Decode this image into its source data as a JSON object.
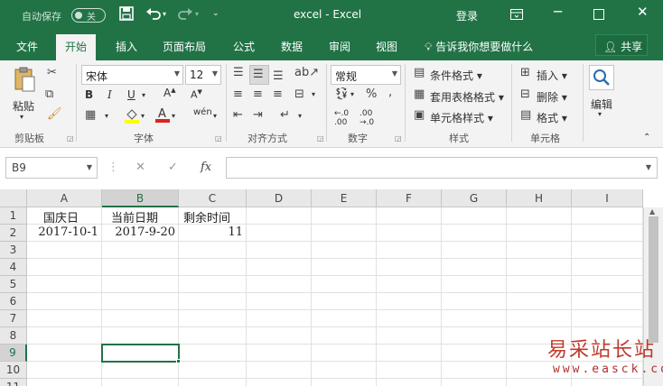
{
  "titlebar": {
    "autosave_label": "自动保存",
    "autosave_state": "关",
    "doc_title": "excel  -  Excel",
    "login": "登录"
  },
  "tabs": [
    "文件",
    "开始",
    "插入",
    "页面布局",
    "公式",
    "数据",
    "审阅",
    "视图"
  ],
  "active_tab": "开始",
  "tell_me": "告诉我你想要做什么",
  "share": "共享",
  "ribbon": {
    "clipboard": {
      "paste": "粘贴",
      "label": "剪贴板"
    },
    "font": {
      "name": "宋体",
      "size": "12",
      "label": "字体",
      "phonetic": "wén"
    },
    "alignment": {
      "label": "对齐方式"
    },
    "number": {
      "format": "常规",
      "label": "数字"
    },
    "styles": {
      "conditional": "条件格式",
      "table": "套用表格格式",
      "cell": "单元格样式",
      "label": "样式"
    },
    "cells": {
      "insert": "插入",
      "delete": "删除",
      "format": "格式",
      "label": "单元格"
    },
    "editing": {
      "label": "编辑"
    }
  },
  "name_box": "B9",
  "formula": "",
  "grid": {
    "columns": [
      "A",
      "B",
      "C",
      "D",
      "E",
      "F",
      "G",
      "H",
      "I"
    ],
    "selected_column": "B",
    "rows": [
      "1",
      "2",
      "3",
      "4",
      "5",
      "6",
      "7",
      "8",
      "9",
      "10",
      "11"
    ],
    "selected_row": "9",
    "cells": {
      "A1": "国庆日",
      "B1": "当前日期",
      "C1": "剩余时间",
      "A2": "2017-10-1",
      "B2": "2017-9-20",
      "C2": "11"
    }
  },
  "watermark": {
    "line1": "易采站长站",
    "line2": "www.easck.com"
  },
  "colors": {
    "accent": "#217346",
    "watermark": "#c0392b"
  }
}
